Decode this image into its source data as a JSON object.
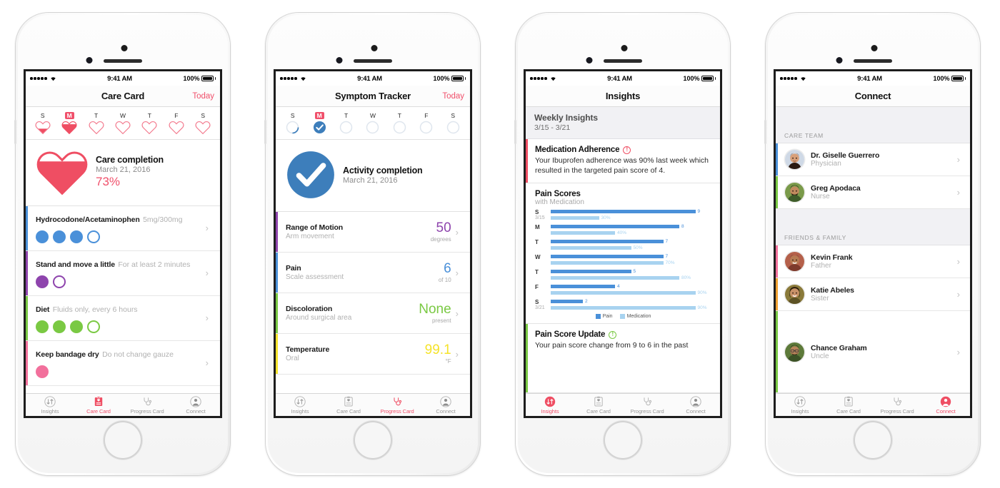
{
  "status_bar": {
    "time": "9:41 AM",
    "battery": "100%",
    "signal_dots": 5
  },
  "phones": [
    {
      "id": "care-card",
      "nav": {
        "title": "Care Card",
        "right_action": "Today"
      },
      "week": {
        "days": [
          {
            "label": "S",
            "fill": 40,
            "selected": false
          },
          {
            "label": "M",
            "fill": 73,
            "selected": true
          },
          {
            "label": "T",
            "fill": 0,
            "selected": false
          },
          {
            "label": "W",
            "fill": 0,
            "selected": false
          },
          {
            "label": "T",
            "fill": 0,
            "selected": false
          },
          {
            "label": "F",
            "fill": 0,
            "selected": false
          },
          {
            "label": "S",
            "fill": 0,
            "selected": false
          }
        ]
      },
      "completion": {
        "title": "Care completion",
        "date": "March 21, 2016",
        "percent": "73%",
        "fill": 73,
        "color": "#ef4e63"
      },
      "rows": [
        {
          "title": "Hydrocodone/Acetaminophen",
          "subtitle": "5mg/300mg",
          "color": "#4a90d9",
          "pips": [
            1,
            1,
            1,
            0
          ]
        },
        {
          "title": "Stand and move a little",
          "subtitle": "For at least 2 minutes",
          "color": "#8e44ad",
          "pips": [
            1,
            0
          ]
        },
        {
          "title": "Diet",
          "subtitle": "Fluids only, every 6 hours",
          "color": "#7ac943",
          "pips": [
            1,
            1,
            1,
            0
          ]
        },
        {
          "title": "Keep bandage dry",
          "subtitle": "Do not change gauze",
          "color": "#f2709c",
          "pips": [
            1
          ]
        }
      ],
      "tabs": [
        {
          "label": "Insights",
          "icon": "insights-icon",
          "active": false
        },
        {
          "label": "Care Card",
          "icon": "care-card-icon",
          "active": true
        },
        {
          "label": "Progress Card",
          "icon": "stethoscope-icon",
          "active": false
        },
        {
          "label": "Connect",
          "icon": "person-icon",
          "active": false
        }
      ]
    },
    {
      "id": "symptom-tracker",
      "nav": {
        "title": "Symptom Tracker",
        "right_action": "Today"
      },
      "week": {
        "days": [
          {
            "label": "S",
            "fill": 40,
            "selected": false
          },
          {
            "label": "M",
            "fill": 100,
            "selected": true
          },
          {
            "label": "T",
            "fill": 0,
            "selected": false
          },
          {
            "label": "W",
            "fill": 0,
            "selected": false
          },
          {
            "label": "T",
            "fill": 0,
            "selected": false
          },
          {
            "label": "F",
            "fill": 0,
            "selected": false
          },
          {
            "label": "S",
            "fill": 0,
            "selected": false
          }
        ]
      },
      "completion": {
        "title": "Activity completion",
        "date": "March 21, 2016",
        "color": "#3d7ebb"
      },
      "rows": [
        {
          "title": "Range of Motion",
          "subtitle": "Arm movement",
          "color": "#8e44ad",
          "value": "50",
          "unit": "degrees"
        },
        {
          "title": "Pain",
          "subtitle": "Scale assessment",
          "color": "#4a90d9",
          "value": "6",
          "unit": "of 10"
        },
        {
          "title": "Discoloration",
          "subtitle": "Around surgical area",
          "color": "#7ac943",
          "value": "None",
          "unit": "present"
        },
        {
          "title": "Temperature",
          "subtitle": "Oral",
          "color": "#f5e32a",
          "value": "99.1",
          "unit": "°F"
        }
      ],
      "tabs": [
        {
          "label": "Insights",
          "icon": "insights-icon",
          "active": false
        },
        {
          "label": "Care Card",
          "icon": "care-card-icon",
          "active": false
        },
        {
          "label": "Progress Card",
          "icon": "stethoscope-icon",
          "active": true
        },
        {
          "label": "Connect",
          "icon": "person-icon",
          "active": false
        }
      ]
    },
    {
      "id": "insights",
      "nav": {
        "title": "Insights",
        "right_action": ""
      },
      "header": {
        "title": "Weekly Insights",
        "date_range": "3/15 - 3/21"
      },
      "cards": [
        {
          "title": "Medication Adherence",
          "body": "Your Ibuprofen adherence was 90% last week which resulted in the targeted pain score of 4.",
          "stripe": "#ef4e63",
          "icon_color": "#ef4e63"
        },
        {
          "title": "Pain Score Update",
          "body": "Your pain score change from 9 to 6 in the past",
          "stripe": "#7ac943",
          "icon_color": "#7ac943"
        }
      ],
      "tabs": [
        {
          "label": "Insights",
          "icon": "insights-icon",
          "active": true
        },
        {
          "label": "Care Card",
          "icon": "care-card-icon",
          "active": false
        },
        {
          "label": "Progress Card",
          "icon": "stethoscope-icon",
          "active": false
        },
        {
          "label": "Connect",
          "icon": "person-icon",
          "active": false
        }
      ]
    },
    {
      "id": "connect",
      "nav": {
        "title": "Connect",
        "right_action": ""
      },
      "sections": [
        {
          "header": "CARE TEAM",
          "contacts": [
            {
              "name": "Dr. Giselle Guerrero",
              "role": "Physician",
              "stripe": "#4a90d9",
              "skin": "#d8a07a",
              "hair": "#2a1a12",
              "bg": "#cfd9e6"
            },
            {
              "name": "Greg Apodaca",
              "role": "Nurse",
              "stripe": "#7ac943",
              "skin": "#c08a5e",
              "hair": "#1b1208",
              "bg": "#7a9a4a"
            }
          ]
        },
        {
          "header": "FRIENDS & FAMILY",
          "contacts": [
            {
              "name": "Kevin Frank",
              "role": "Father",
              "stripe": "#f2709c",
              "skin": "#b57a52",
              "hair": "#3a2a1c",
              "bg": "#b4604a"
            },
            {
              "name": "Katie Abeles",
              "role": "Sister",
              "stripe": "#f0a030",
              "skin": "#c89068",
              "hair": "#241409",
              "bg": "#8a7a3a"
            },
            {
              "name": "Chance Graham",
              "role": "Uncle",
              "stripe": "#7ac943",
              "skin": "#b8845a",
              "hair": "#2a1c10",
              "bg": "#5d7a3a"
            }
          ]
        }
      ],
      "tabs": [
        {
          "label": "Insights",
          "icon": "insights-icon",
          "active": false
        },
        {
          "label": "Care Card",
          "icon": "care-card-icon",
          "active": false
        },
        {
          "label": "Progress Card",
          "icon": "stethoscope-icon",
          "active": false
        },
        {
          "label": "Connect",
          "icon": "person-icon",
          "active": true
        }
      ]
    }
  ],
  "chart_data": {
    "type": "bar",
    "title": "Pain Scores",
    "subtitle": "with Medication",
    "orientation": "horizontal",
    "categories": [
      "S",
      "M",
      "T",
      "W",
      "T",
      "F",
      "S"
    ],
    "category_sublabels": [
      "3/15",
      "",
      "",
      "",
      "",
      "",
      "3/21"
    ],
    "series": [
      {
        "name": "Pain",
        "color": "#4a90d9",
        "max": 10,
        "values": [
          9,
          8,
          7,
          7,
          5,
          4,
          2
        ],
        "value_labels": [
          "9",
          "8",
          "7",
          "7",
          "5",
          "4",
          "2"
        ]
      },
      {
        "name": "Medication",
        "color": "#a8d3f0",
        "max": 100,
        "values": [
          30,
          40,
          50,
          70,
          80,
          90,
          90
        ],
        "value_labels": [
          "30%",
          "40%",
          "50%",
          "70%",
          "80%",
          "90%",
          "90%"
        ]
      }
    ],
    "legend": [
      "Pain",
      "Medication"
    ],
    "legend_position": "bottom",
    "grid": false
  },
  "colors": {
    "accent_red": "#ef4e63",
    "blue": "#4a90d9",
    "light_blue": "#a8d3f0",
    "green": "#7ac943",
    "purple": "#8e44ad",
    "pink": "#f2709c",
    "yellow": "#f5e32a"
  }
}
